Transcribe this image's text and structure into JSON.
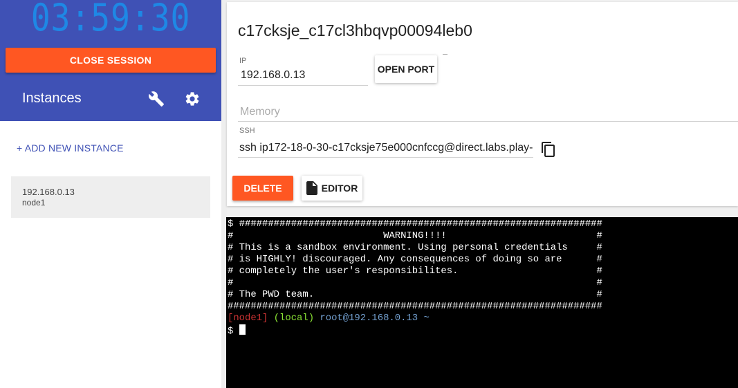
{
  "session": {
    "timer": "03:59:30",
    "close_label": "CLOSE SESSION"
  },
  "sidebar": {
    "title": "Instances",
    "add_label": "+ ADD NEW INSTANCE",
    "instances": [
      {
        "ip": "192.168.0.13",
        "name": "node1"
      }
    ]
  },
  "instance": {
    "hostname": "c17cksje_c17cl3hbqvp00094leb0",
    "ip_label": "IP",
    "ip_value": "192.168.0.13",
    "open_port_label": "OPEN PORT",
    "memory_label": "Memory",
    "ssh_label": "SSH",
    "ssh_value": "ssh ip172-18-0-30-c17cksje75e000cnfccg@direct.labs.play-",
    "delete_label": "DELETE",
    "editor_label": "EDITOR"
  },
  "terminal": {
    "lines": [
      "$ ###############################################################",
      "#                          WARNING!!!!                          #",
      "# This is a sandbox environment. Using personal credentials     #",
      "# is HIGHLY! discouraged. Any consequences of doing so are      #",
      "# completely the user's responsibilites.                        #",
      "#                                                               #",
      "# The PWD team.                                                 #",
      "#################################################################"
    ],
    "prompt_node": "[node1]",
    "prompt_env": "(local)",
    "prompt_host": "root@192.168.0.13 ~",
    "prompt_symbol": "$"
  },
  "colors": {
    "sidebar_header": "#3f51b5",
    "accent_orange": "#ff5722",
    "timer_blue": "#1e88e5",
    "link_indigo": "#3f51b5"
  }
}
